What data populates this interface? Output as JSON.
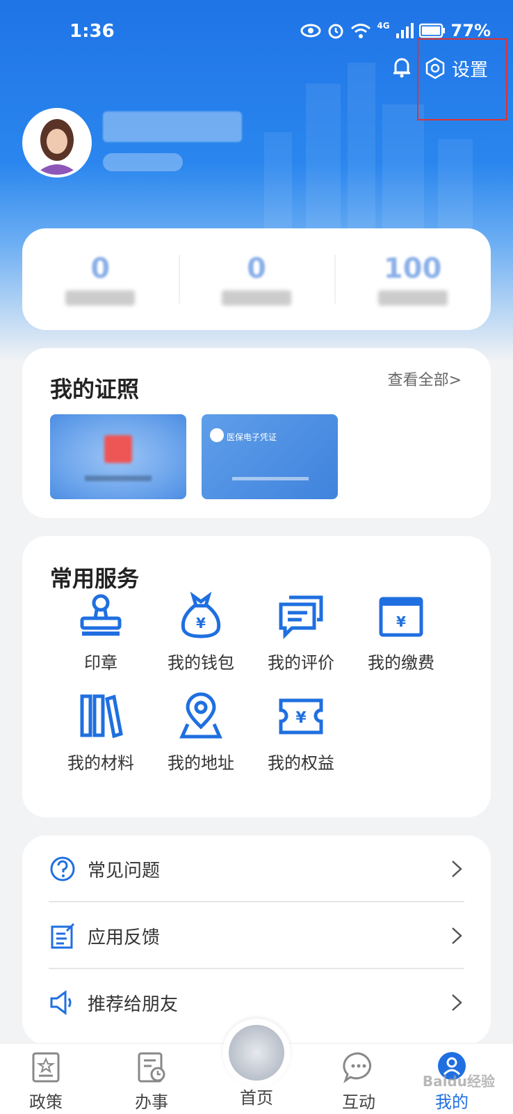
{
  "status_bar": {
    "time": "1:36",
    "network": "4G",
    "battery": "77%"
  },
  "header": {
    "settings_label": "设置"
  },
  "stats": [
    {
      "value": "0"
    },
    {
      "value": "0"
    },
    {
      "value": "100"
    }
  ],
  "certificates": {
    "title": "我的证照",
    "view_all": "查看全部>",
    "card_2_caption": "医保电子凭证"
  },
  "services": {
    "title": "常用服务",
    "items": [
      {
        "label": "印章",
        "icon": "stamp-icon"
      },
      {
        "label": "我的钱包",
        "icon": "money-bag-icon"
      },
      {
        "label": "我的评价",
        "icon": "comment-icon"
      },
      {
        "label": "我的缴费",
        "icon": "payment-card-icon"
      },
      {
        "label": "我的材料",
        "icon": "books-icon"
      },
      {
        "label": "我的地址",
        "icon": "location-pin-icon"
      },
      {
        "label": "我的权益",
        "icon": "coupon-icon"
      }
    ]
  },
  "menu": [
    {
      "label": "常见问题",
      "icon": "question-icon"
    },
    {
      "label": "应用反馈",
      "icon": "feedback-icon"
    },
    {
      "label": "推荐给朋友",
      "icon": "speaker-icon"
    }
  ],
  "tabbar": {
    "tabs": [
      {
        "label": "政策"
      },
      {
        "label": "办事"
      },
      {
        "label": "首页"
      },
      {
        "label": "互动"
      },
      {
        "label": "我的"
      }
    ],
    "active": "我的",
    "watermark": "Baidu经验"
  },
  "colors": {
    "accent": "#1f6fe0",
    "hero_top": "#1f74e6",
    "highlight": "#dd3333"
  }
}
